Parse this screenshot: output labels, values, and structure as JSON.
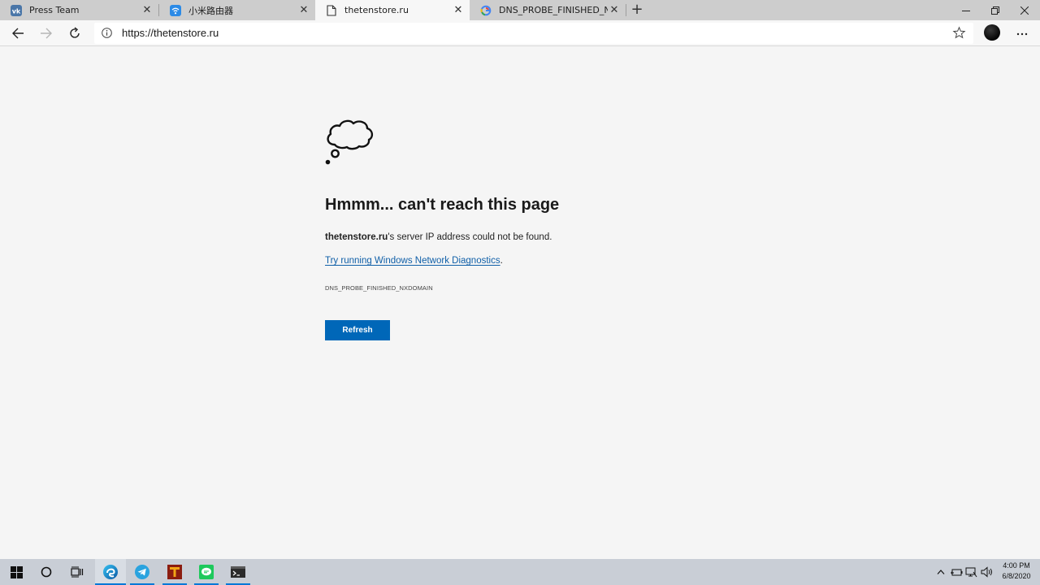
{
  "tabs": [
    {
      "title": "Press Team",
      "favicon": "vk-icon",
      "active": false
    },
    {
      "title": "小米路由器",
      "favicon": "wifi-icon",
      "active": false
    },
    {
      "title": "thetenstore.ru",
      "favicon": "page-icon",
      "active": true
    },
    {
      "title": "DNS_PROBE_FINISHED_NXDOMAIN",
      "favicon": "google-icon",
      "active": false
    }
  ],
  "toolbar": {
    "url": "https://thetenstore.ru"
  },
  "error_page": {
    "heading": "Hmmm... can't reach this page",
    "host": "thetenstore.ru",
    "message_suffix": "'s server IP address could not be found.",
    "diagnostics_link": "Try running Windows Network Diagnostics",
    "diagnostics_period": ".",
    "error_code": "DNS_PROBE_FINISHED_NXDOMAIN",
    "refresh_label": "Refresh"
  },
  "taskbar": {
    "time": "4:00 PM",
    "date": "6/8/2020"
  },
  "colors": {
    "accent": "#0067b8",
    "link": "#0f5fa8",
    "taskbar": "#c9ced6"
  }
}
